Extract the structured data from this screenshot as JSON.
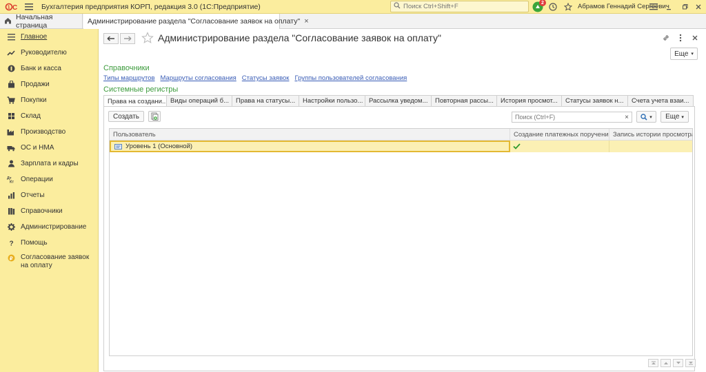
{
  "titlebar": {
    "logo_text": "1С",
    "app_title": "Бухгалтерия предприятия КОРП, редакция 3.0  (1С:Предприятие)",
    "search_placeholder": "Поиск Ctrl+Shift+F",
    "notification_count": "2",
    "username": "Абрамов Геннадий Сергеевич"
  },
  "tabs": {
    "home_label": "Начальная страница",
    "doc_label": "Администрирование раздела \"Согласование заявок на оплату\""
  },
  "sidebar": {
    "items": [
      {
        "label": "Главное",
        "icon": "menu-icon"
      },
      {
        "label": "Руководителю",
        "icon": "trend-icon"
      },
      {
        "label": "Банк и касса",
        "icon": "bank-icon"
      },
      {
        "label": "Продажи",
        "icon": "bag-icon"
      },
      {
        "label": "Покупки",
        "icon": "cart-icon"
      },
      {
        "label": "Склад",
        "icon": "warehouse-icon"
      },
      {
        "label": "Производство",
        "icon": "factory-icon"
      },
      {
        "label": "ОС и НМА",
        "icon": "truck-icon"
      },
      {
        "label": "Зарплата и кадры",
        "icon": "person-icon"
      },
      {
        "label": "Операции",
        "icon": "operations-icon"
      },
      {
        "label": "Отчеты",
        "icon": "report-icon"
      },
      {
        "label": "Справочники",
        "icon": "books-icon"
      },
      {
        "label": "Администрирование",
        "icon": "gear-icon"
      },
      {
        "label": "Помощь",
        "icon": "question-icon"
      },
      {
        "label": "Согласование заявок на оплату",
        "icon": "coin-icon"
      }
    ]
  },
  "main": {
    "title": "Администрирование раздела \"Согласование заявок на оплату\"",
    "more_label": "Еще",
    "section_refs": "Справочники",
    "links": [
      "Типы маршрутов",
      "Маршруты согласования",
      "Статусы заявок",
      "Группы пользователей согласования"
    ],
    "section_registers": "Системные регистры",
    "register_tabs": [
      "Права на создани...",
      "Виды операций б...",
      "Права на статусы...",
      "Настройки пользо...",
      "Рассылка уведом...",
      "Повторная рассы...",
      "История просмот...",
      "Статусы заявок н...",
      "Счета учета взаи..."
    ],
    "create_label": "Создать",
    "list_search_placeholder": "Поиск (Ctrl+F)",
    "list_more_label": "Еще",
    "columns": [
      "Пользователь",
      "Создание платежных поручений",
      "Запись истории просмотра"
    ],
    "rows": [
      {
        "user": "Уровень 1 (Основной)",
        "create_payments": true,
        "history": false
      }
    ]
  },
  "colors": {
    "sidebar_bg": "#fbed9e",
    "section_green": "#3b9a3b",
    "link_blue": "#3a5db6",
    "selection_border": "#e3b932",
    "check_green": "#2f9a2f"
  }
}
